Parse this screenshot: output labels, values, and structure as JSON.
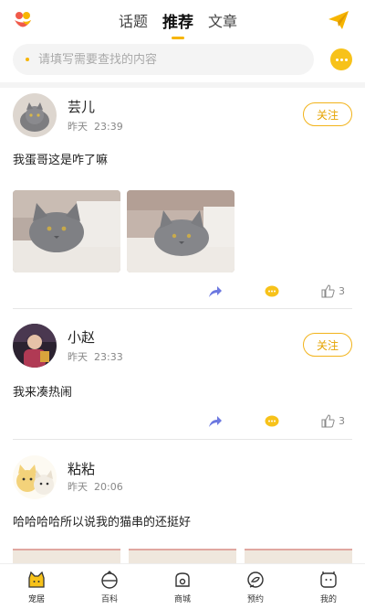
{
  "header": {
    "tabs": [
      {
        "label": "话题",
        "active": false
      },
      {
        "label": "推荐",
        "active": true
      },
      {
        "label": "文章",
        "active": false
      }
    ],
    "accent_color": "#f7b500"
  },
  "search": {
    "placeholder": "请填写需要查找的内容"
  },
  "posts": [
    {
      "username": "芸儿",
      "day": "昨天",
      "time": "23:39",
      "follow_label": "关注",
      "text": "我蛋哥这是咋了嘛",
      "likes": "3"
    },
    {
      "username": "小赵",
      "day": "昨天",
      "time": "23:33",
      "follow_label": "关注",
      "text": "我来凑热闹",
      "likes": "3"
    },
    {
      "username": "粘粘",
      "day": "昨天",
      "time": "20:06",
      "text": "哈哈哈哈所以说我的猫串的还挺好"
    }
  ],
  "bottom_nav": [
    {
      "label": "宠居",
      "icon": "home-cat-icon",
      "active": true
    },
    {
      "label": "百科",
      "icon": "encyclopedia-icon",
      "active": false
    },
    {
      "label": "商城",
      "icon": "shop-bag-icon",
      "active": false
    },
    {
      "label": "预约",
      "icon": "appointment-icon",
      "active": false
    },
    {
      "label": "我的",
      "icon": "profile-icon",
      "active": false
    }
  ]
}
